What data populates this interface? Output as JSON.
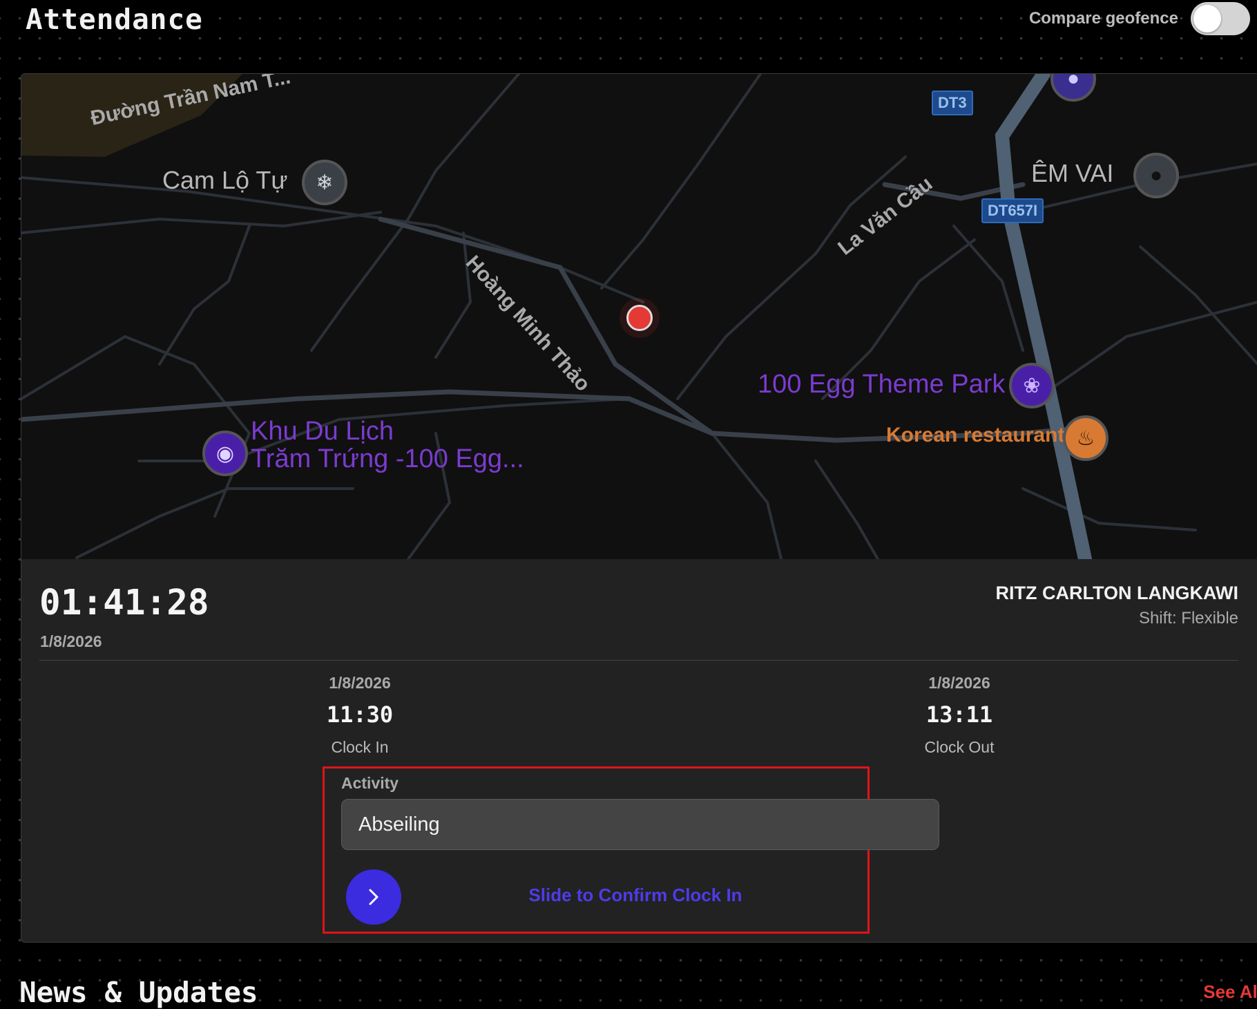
{
  "header": {
    "title": "Attendance",
    "geofence_label": "Compare geofence",
    "geofence_on": false
  },
  "map": {
    "road_labels": [
      "Đường Trần Nam T...",
      "Hoàng Minh Thảo",
      "La Văn Cầu"
    ],
    "place_labels": [
      "Cam Lộ Tự",
      "ÊM VAI"
    ],
    "shields": [
      "DT3",
      "DT657I"
    ],
    "pois": {
      "khu_du_lich_line1": "Khu Du Lịch",
      "khu_du_lich_line2": "Trăm Trứng -100 Egg...",
      "egg_park": "100 Egg Theme Park",
      "korean": "Korean restaurant"
    },
    "colors": {
      "poi_purple": "#7b3bd0",
      "poi_orange": "#d87a33",
      "location_dot": "#e53935"
    }
  },
  "session": {
    "elapsed": "01:41:28",
    "date": "1/8/2026",
    "site_name": "RITZ CARLTON LANGKAWI",
    "shift": "Shift: Flexible"
  },
  "clock_in": {
    "date": "1/8/2026",
    "time": "11:30",
    "label": "Clock In"
  },
  "clock_out": {
    "date": "1/8/2026",
    "time": "13:11",
    "label": "Clock Out"
  },
  "activity": {
    "label": "Activity",
    "value": "Abseiling"
  },
  "slider": {
    "text": "Slide to Confirm Clock In",
    "icon": "chevron-right-icon",
    "color": "#3b2ce0"
  },
  "news": {
    "title": "News & Updates",
    "see_all": "See All"
  }
}
